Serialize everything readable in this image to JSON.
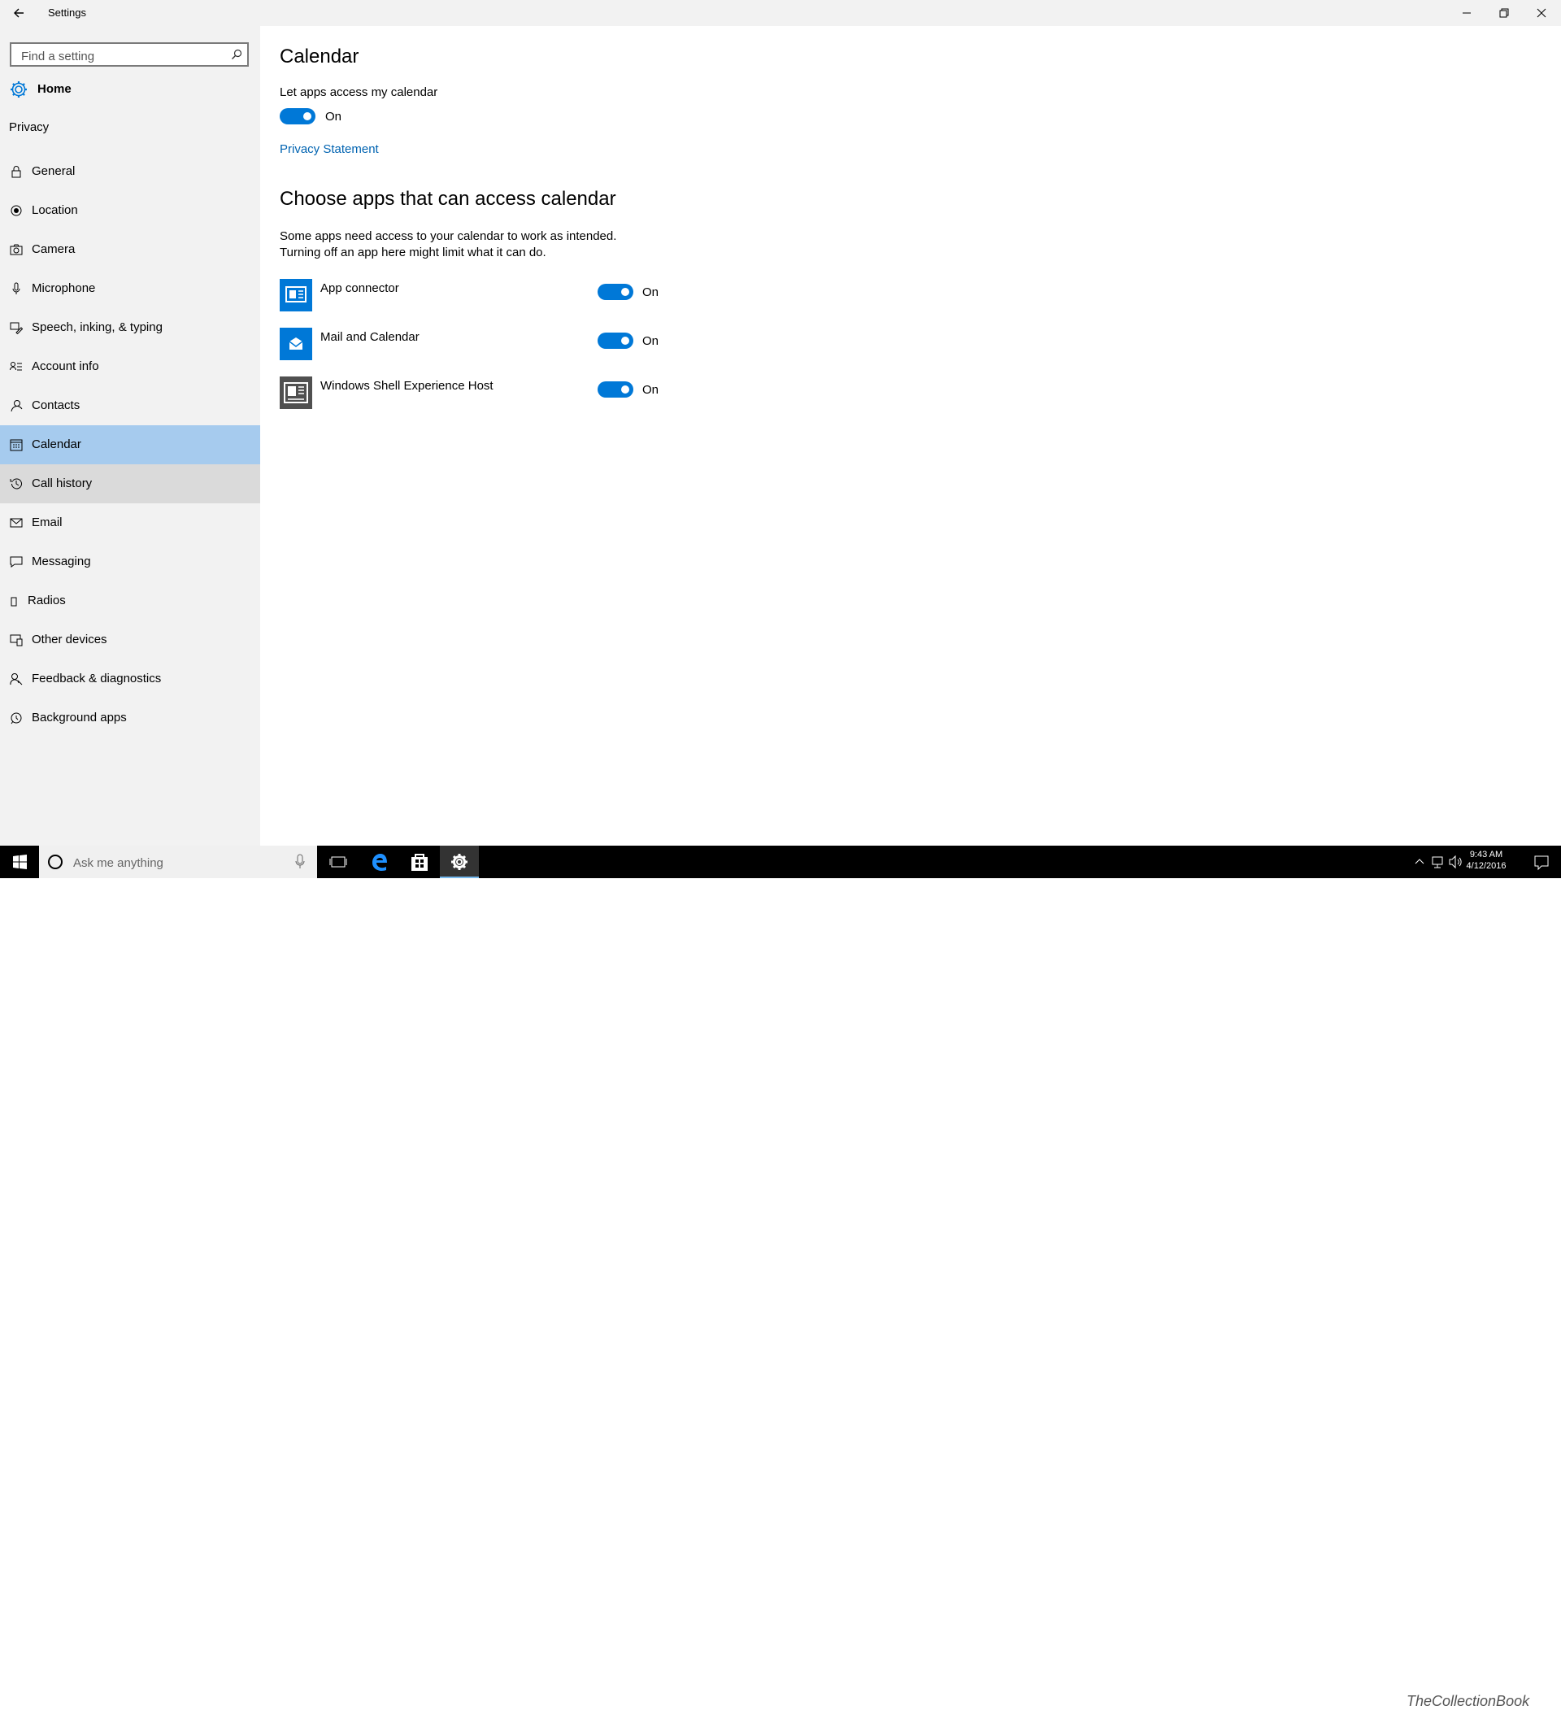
{
  "window": {
    "title": "Settings"
  },
  "sidebar": {
    "search_placeholder": "Find a setting",
    "home_label": "Home",
    "section_label": "Privacy",
    "items": [
      {
        "label": "General",
        "icon": "lock-icon"
      },
      {
        "label": "Location",
        "icon": "location-icon"
      },
      {
        "label": "Camera",
        "icon": "camera-icon"
      },
      {
        "label": "Microphone",
        "icon": "microphone-icon"
      },
      {
        "label": "Speech, inking, & typing",
        "icon": "pen-icon"
      },
      {
        "label": "Account info",
        "icon": "account-info-icon"
      },
      {
        "label": "Contacts",
        "icon": "contacts-icon"
      },
      {
        "label": "Calendar",
        "icon": "calendar-icon",
        "selected": true
      },
      {
        "label": "Call history",
        "icon": "history-icon",
        "hover": true
      },
      {
        "label": "Email",
        "icon": "mail-icon"
      },
      {
        "label": "Messaging",
        "icon": "message-icon"
      },
      {
        "label": "Radios",
        "icon": "phone-icon"
      },
      {
        "label": "Other devices",
        "icon": "devices-icon"
      },
      {
        "label": "Feedback & diagnostics",
        "icon": "feedback-icon"
      },
      {
        "label": "Background apps",
        "icon": "background-apps-icon"
      }
    ]
  },
  "main": {
    "title": "Calendar",
    "master_toggle_label": "Let apps access my calendar",
    "master_toggle_state": "On",
    "privacy_link": "Privacy Statement",
    "section_title": "Choose apps that can access calendar",
    "description_line1": "Some apps need access to your calendar to work as intended.",
    "description_line2": "Turning off an app here might limit what it can do.",
    "apps": [
      {
        "name": "App connector",
        "state": "On",
        "icon": "app-connector-icon"
      },
      {
        "name": "Mail and Calendar",
        "state": "On",
        "icon": "mail-calendar-icon"
      },
      {
        "name": "Windows Shell Experience Host",
        "state": "On",
        "icon": "shell-host-icon"
      }
    ]
  },
  "taskbar": {
    "search_placeholder": "Ask me anything",
    "time": "9:43 AM",
    "date": "4/12/2016",
    "watermark": "TheCollectionBook"
  },
  "colors": {
    "accent": "#0078d7",
    "selected_bg": "#a6cbee",
    "link": "#0063b1"
  }
}
